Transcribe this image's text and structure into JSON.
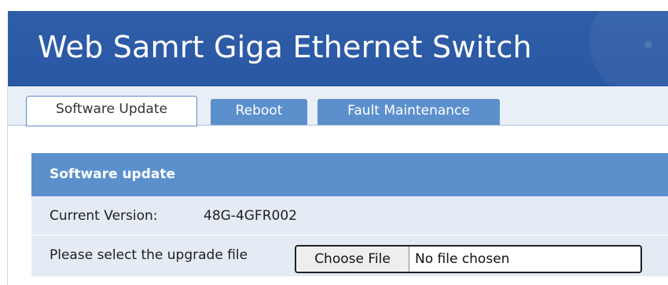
{
  "header": {
    "title": "Web Samrt Giga Ethernet Switch"
  },
  "tabs": [
    {
      "label": "Software Update",
      "active": true
    },
    {
      "label": "Reboot",
      "active": false
    },
    {
      "label": "Fault Maintenance",
      "active": false
    }
  ],
  "panel": {
    "title": "Software update",
    "current_version_label": "Current Version:",
    "current_version_value": "48G-4GFR002",
    "upgrade_label": "Please select the upgrade file",
    "choose_file_label": "Choose File",
    "file_status": "No file chosen"
  },
  "colors": {
    "header_bg": "#2c5aa6",
    "tab_inactive_bg": "#5b90cd",
    "panel_header_bg": "#5b90cd",
    "row_bg": "#e4ebf5"
  }
}
